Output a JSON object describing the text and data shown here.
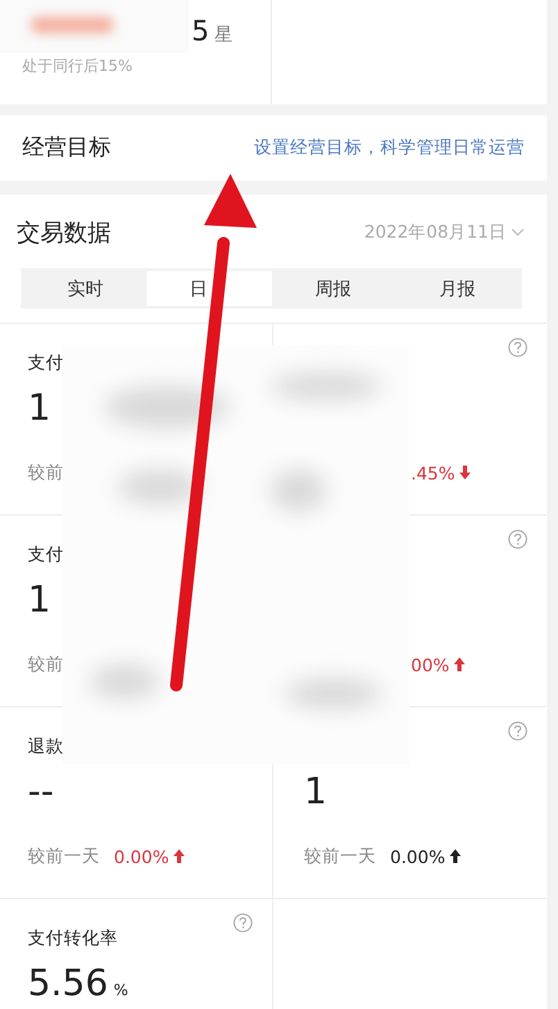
{
  "rating": {
    "score": "5",
    "unit": "星",
    "note": "处于同行后15%"
  },
  "goal": {
    "title": "经营目标",
    "link": "设置经营目标，科学管理日常运营"
  },
  "trade": {
    "title": "交易数据",
    "date": "2022年08月11日",
    "tabs": [
      {
        "label": "实时",
        "selected": false
      },
      {
        "label": "日",
        "selected": true
      },
      {
        "label": "周报",
        "selected": false
      },
      {
        "label": "月报",
        "selected": false
      }
    ],
    "metrics": [
      {
        "kind": "stat",
        "label": "支付",
        "value": "1",
        "compare_label": "较前"
      },
      {
        "kind": "stat",
        "help": true,
        "change": ".45%",
        "rising": false,
        "color": "#d9363e"
      },
      {
        "kind": "stat",
        "label": "支付",
        "value": "1",
        "compare_label": "较前"
      },
      {
        "kind": "stat",
        "help": true,
        "change": "00%",
        "rising": true,
        "color": "#d9363e"
      },
      {
        "kind": "stat",
        "label": "退款",
        "value": "--",
        "compare_label": "较前一天",
        "change": "0.00%",
        "rising": true,
        "color": "#d9363e"
      },
      {
        "kind": "stat",
        "help": true,
        "value": "1",
        "compare_label": "较前一天",
        "change": "0.00%",
        "rising": true,
        "color": "#222222"
      },
      {
        "kind": "stat",
        "label": "支付转化率",
        "help": true,
        "value": "5.56",
        "unit": "%"
      },
      {
        "kind": "empty"
      }
    ]
  }
}
